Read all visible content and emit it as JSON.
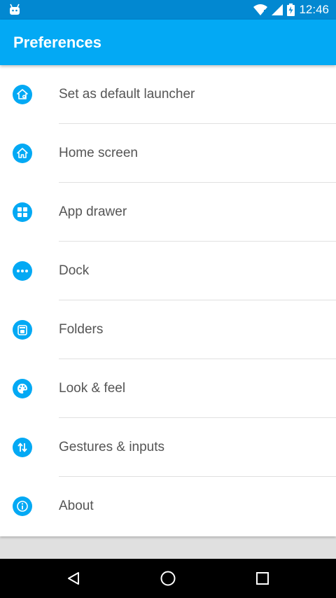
{
  "status_bar": {
    "time": "12:46",
    "icons": [
      "android-icon",
      "wifi-icon",
      "signal-icon",
      "battery-charging-icon"
    ]
  },
  "app_bar": {
    "title": "Preferences"
  },
  "preferences": [
    {
      "icon": "home-settings-icon",
      "label": "Set as default launcher"
    },
    {
      "icon": "home-icon",
      "label": "Home screen"
    },
    {
      "icon": "apps-grid-icon",
      "label": "App drawer"
    },
    {
      "icon": "more-dots-icon",
      "label": "Dock"
    },
    {
      "icon": "folder-icon",
      "label": "Folders"
    },
    {
      "icon": "palette-icon",
      "label": "Look & feel"
    },
    {
      "icon": "swap-vertical-icon",
      "label": "Gestures & inputs"
    },
    {
      "icon": "info-icon",
      "label": "About"
    }
  ],
  "nav_bar": {
    "buttons": [
      "back-icon",
      "home-circle-icon",
      "recents-icon"
    ]
  },
  "colors": {
    "status_bar": "#0288d1",
    "app_bar": "#03a9f4",
    "accent": "#03a9f4",
    "background": "#e0e0e0",
    "nav_bar": "#000000"
  }
}
